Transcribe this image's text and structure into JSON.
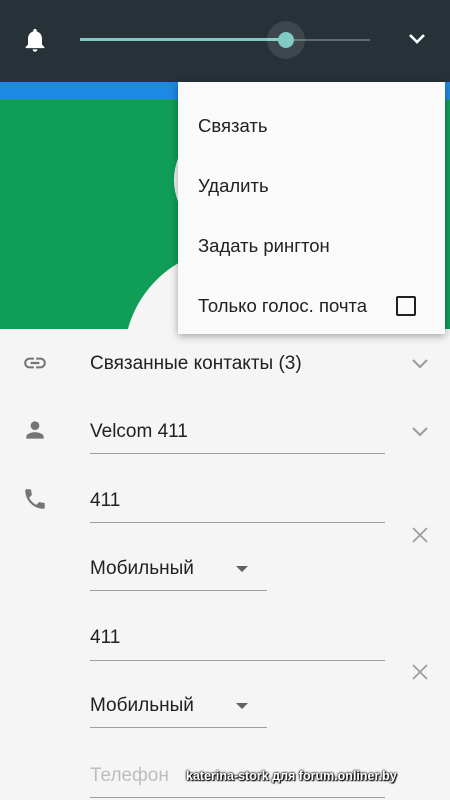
{
  "volume": {
    "level_fraction": 0.71
  },
  "menu": {
    "items": [
      "Связать",
      "Удалить",
      "Задать рингтон",
      "Только голос. почта"
    ],
    "voicemail_checked": false
  },
  "linked": {
    "label": "Связанные контакты (3)"
  },
  "name": {
    "value": "Velcom 411"
  },
  "phones": [
    {
      "number": "411",
      "type": "Мобильный"
    },
    {
      "number": "411",
      "type": "Мобильный"
    }
  ],
  "new_phone": {
    "placeholder": "Телефон"
  },
  "watermark": "katerina-stork для forum.onliner.by",
  "colors": {
    "status_bar": "#263238",
    "accent": "#80cbc4",
    "photo_bg": "#109d58",
    "strip": "#1e88e5"
  }
}
